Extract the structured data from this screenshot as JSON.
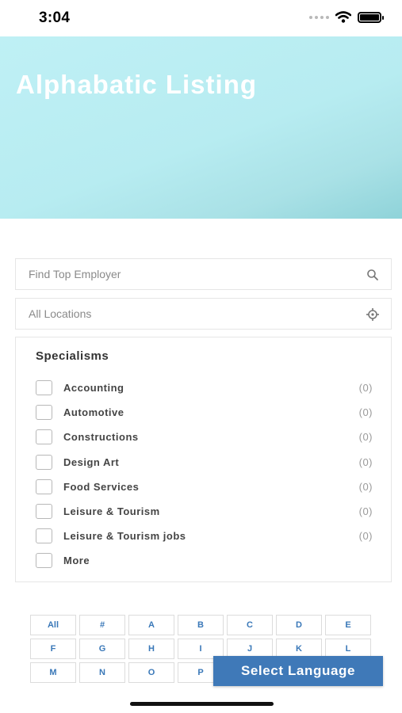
{
  "status_bar": {
    "time": "3:04"
  },
  "hero": {
    "title": "Alphabatic Listing"
  },
  "search": {
    "employer_placeholder": "Find Top Employer",
    "location_placeholder": "All Locations"
  },
  "specialisms": {
    "title": "Specialisms",
    "items": [
      {
        "label": "Accounting",
        "count": "(0)"
      },
      {
        "label": "Automotive",
        "count": "(0)"
      },
      {
        "label": "Constructions",
        "count": "(0)"
      },
      {
        "label": "Design Art",
        "count": "(0)"
      },
      {
        "label": "Food Services",
        "count": "(0)"
      },
      {
        "label": "Leisure & Tourism",
        "count": "(0)"
      },
      {
        "label": "Leisure & Tourism jobs",
        "count": "(0)"
      },
      {
        "label": "More",
        "count": ""
      }
    ]
  },
  "alphabet": [
    "All",
    "#",
    "A",
    "B",
    "C",
    "D",
    "E",
    "F",
    "G",
    "H",
    "I",
    "J",
    "K",
    "L",
    "M",
    "N",
    "O",
    "P"
  ],
  "language_button": {
    "label": "Select Language"
  },
  "colors": {
    "accent": "#3f79b8",
    "hero": "#bff0f5"
  }
}
